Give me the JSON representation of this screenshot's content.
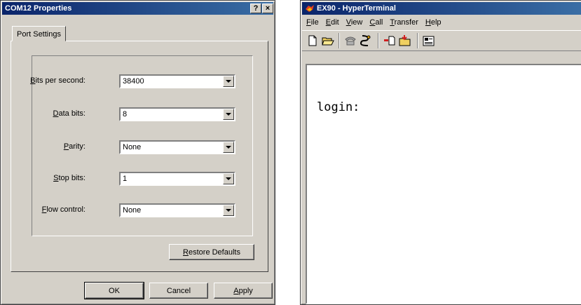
{
  "dialog": {
    "title": "COM12 Properties",
    "title_buttons": {
      "help": "?",
      "close": "×"
    },
    "tab": "Port Settings",
    "fields": [
      {
        "label_pre": "",
        "label_ul": "B",
        "label_post": "its per second:",
        "value": "38400"
      },
      {
        "label_pre": "",
        "label_ul": "D",
        "label_post": "ata bits:",
        "value": "8"
      },
      {
        "label_pre": "",
        "label_ul": "P",
        "label_post": "arity:",
        "value": "None"
      },
      {
        "label_pre": "",
        "label_ul": "S",
        "label_post": "top bits:",
        "value": "1"
      },
      {
        "label_pre": "",
        "label_ul": "F",
        "label_post": "low control:",
        "value": "None"
      }
    ],
    "restore": {
      "ul": "R",
      "rest": "estore Defaults"
    },
    "ok": "OK",
    "cancel": "Cancel",
    "apply": {
      "ul": "A",
      "rest": "pply"
    }
  },
  "terminal_window": {
    "title": "EX90 - HyperTerminal",
    "menu": [
      {
        "ul": "F",
        "rest": "ile"
      },
      {
        "ul": "E",
        "rest": "dit"
      },
      {
        "ul": "V",
        "rest": "iew"
      },
      {
        "ul": "C",
        "rest": "all"
      },
      {
        "ul": "T",
        "rest": "ransfer"
      },
      {
        "ul": "H",
        "rest": "elp"
      }
    ],
    "output": "login:"
  }
}
